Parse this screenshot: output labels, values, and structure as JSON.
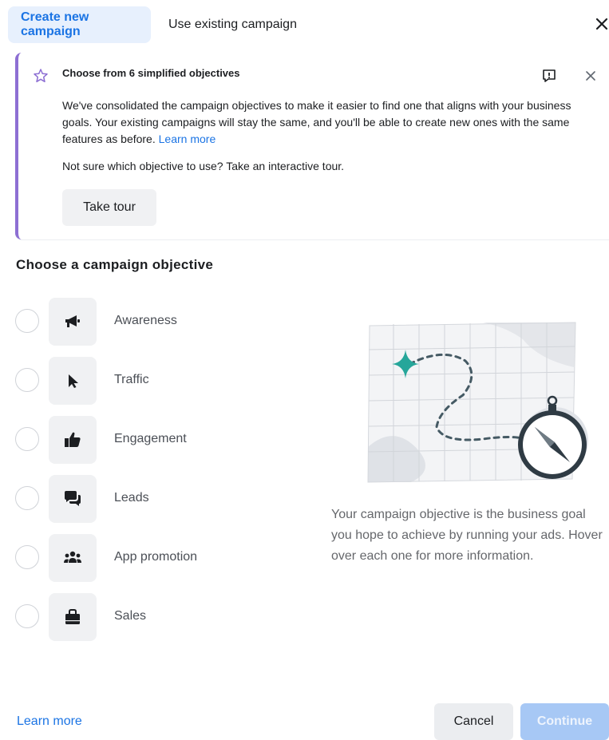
{
  "tabs": {
    "create": "Create new campaign",
    "existing": "Use existing campaign"
  },
  "banner": {
    "title": "Choose from 6 simplified objectives",
    "body": "We've consolidated the campaign objectives to make it easier to find one that aligns with your business goals. Your existing campaigns will stay the same, and you'll be able to create new ones with the same features as before.",
    "body_link": "Learn more",
    "question": "Not sure which objective to use? Take an interactive tour.",
    "tour_button": "Take tour"
  },
  "section_title": "Choose a campaign objective",
  "objectives": [
    {
      "label": "Awareness",
      "icon": "megaphone-icon"
    },
    {
      "label": "Traffic",
      "icon": "cursor-icon"
    },
    {
      "label": "Engagement",
      "icon": "thumbs-up-icon"
    },
    {
      "label": "Leads",
      "icon": "chat-bubbles-icon"
    },
    {
      "label": "App promotion",
      "icon": "people-icon"
    },
    {
      "label": "Sales",
      "icon": "shopping-bag-icon"
    }
  ],
  "info_text": "Your campaign objective is the business goal you hope to achieve by running your ads. Hover over each one for more information.",
  "footer": {
    "learn_more": "Learn more",
    "cancel": "Cancel",
    "continue": "Continue"
  },
  "colors": {
    "accent": "#1b74e4",
    "banner_accent": "#8d6fd3",
    "continue_disabled": "#a7c8f5"
  }
}
